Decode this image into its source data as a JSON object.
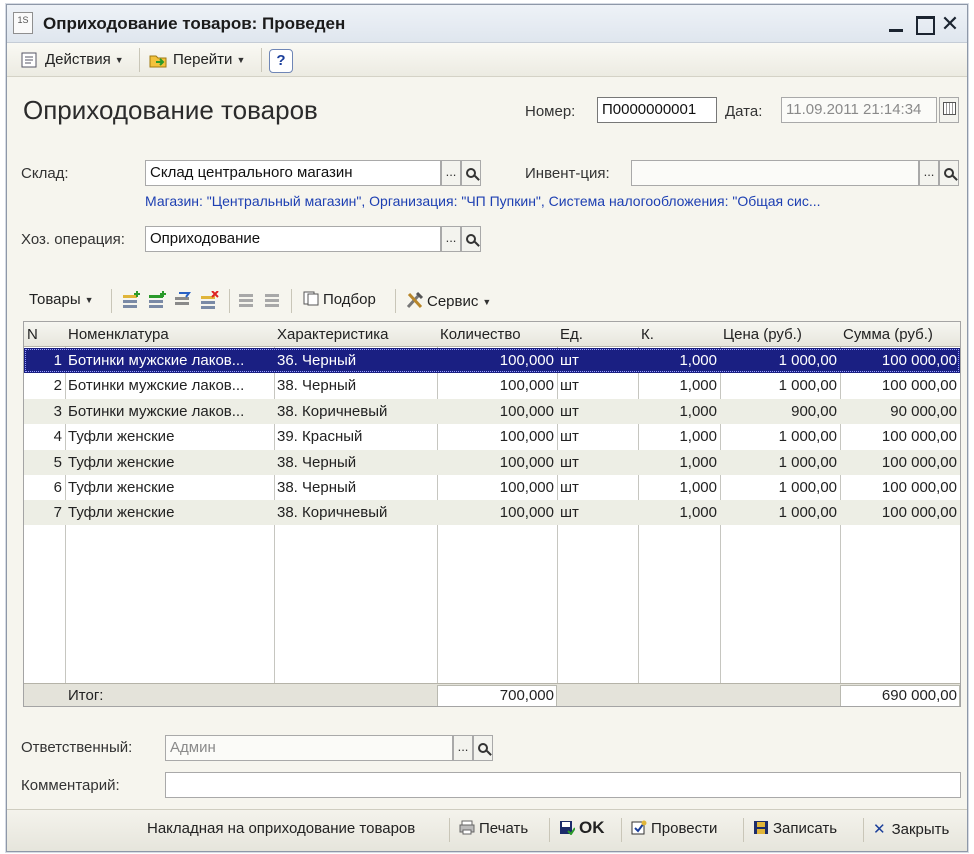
{
  "window": {
    "title": "Оприходование товаров: Проведен",
    "icon_text": "1S"
  },
  "toolbar": {
    "actions_label": "Действия",
    "goto_label": "Перейти",
    "help_label": "?"
  },
  "document": {
    "title": "Оприходование товаров",
    "number_label": "Номер:",
    "number_value": "П0000000001",
    "date_label": "Дата:",
    "date_value": "11.09.2011 21:14:34",
    "warehouse_label": "Склад:",
    "warehouse_value": "Склад центрального магазин",
    "inventory_label": "Инвент-ция:",
    "inventory_value": "",
    "info_line": "Магазин: \"Центральный магазин\", Организация: \"ЧП Пупкин\", Система налогообложения: \"Общая сис...",
    "operation_label": "Хоз. операция:",
    "operation_value": "Оприходование",
    "responsible_label": "Ответственный:",
    "responsible_value": "Админ",
    "comment_label": "Комментарий:",
    "comment_value": ""
  },
  "goods_toolbar": {
    "goods_label": "Товары",
    "pick_label": "Подбор",
    "service_label": "Сервис"
  },
  "table": {
    "columns": [
      "N",
      "Номенклатура",
      "Характеристика",
      "Количество",
      "Ед.",
      "К.",
      "Цена (руб.)",
      "Сумма (руб.)"
    ],
    "rows": [
      [
        "1",
        "Ботинки мужские лаков...",
        "36. Черный",
        "100,000",
        "шт",
        "1,000",
        "1 000,00",
        "100 000,00"
      ],
      [
        "2",
        "Ботинки мужские лаков...",
        "38. Черный",
        "100,000",
        "шт",
        "1,000",
        "1 000,00",
        "100 000,00"
      ],
      [
        "3",
        "Ботинки мужские лаков...",
        "38. Коричневый",
        "100,000",
        "шт",
        "1,000",
        "900,00",
        "90 000,00"
      ],
      [
        "4",
        "Туфли женские",
        "39. Красный",
        "100,000",
        "шт",
        "1,000",
        "1 000,00",
        "100 000,00"
      ],
      [
        "5",
        "Туфли женские",
        "38. Черный",
        "100,000",
        "шт",
        "1,000",
        "1 000,00",
        "100 000,00"
      ],
      [
        "6",
        "Туфли женские",
        "38. Черный",
        "100,000",
        "шт",
        "1,000",
        "1 000,00",
        "100 000,00"
      ],
      [
        "7",
        "Туфли женские",
        "38. Коричневый",
        "100,000",
        "шт",
        "1,000",
        "1 000,00",
        "100 000,00"
      ]
    ],
    "selected_row": 1,
    "totals_label": "Итог:",
    "total_quantity": "700,000",
    "total_sum": "690 000,00"
  },
  "bottom": {
    "invoice_label": "Накладная на оприходование товаров",
    "print_label": "Печать",
    "ok_label": "OK",
    "post_label": "Провести",
    "save_label": "Записать",
    "close_label": "Закрыть"
  },
  "colors": {
    "selection": "#1a1f82",
    "link_blue": "#1d3fb2",
    "alt_row": "#edeee5",
    "window_bg": "#f6f5ee"
  },
  "icons": [
    "app-icon",
    "actions-icon",
    "goto-icon",
    "help-icon",
    "add-row-icon",
    "copy-row-icon",
    "edit-row-icon",
    "delete-row-icon",
    "move-up-icon",
    "move-down-icon",
    "pick-icon",
    "service-tools-icon",
    "select-icon",
    "search-icon",
    "calendar-icon",
    "print-icon",
    "ok-icon",
    "post-icon",
    "save-icon",
    "close-icon"
  ]
}
